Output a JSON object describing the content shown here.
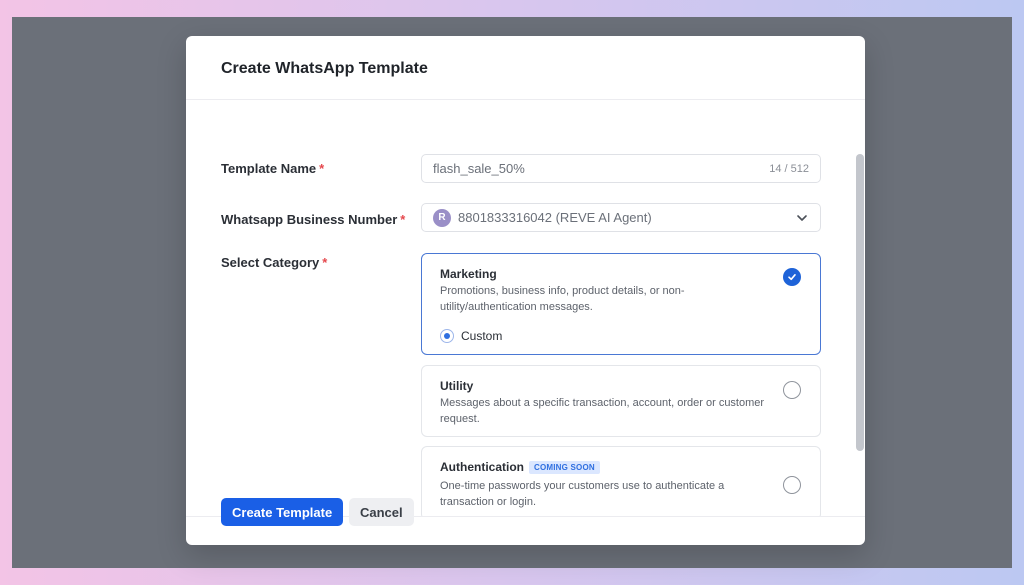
{
  "dialog": {
    "title": "Create WhatsApp Template"
  },
  "form": {
    "template_name": {
      "label": "Template Name",
      "required_mark": "*",
      "value": "flash_sale_50%",
      "counter": "14 / 512"
    },
    "business_number": {
      "label": "Whatsapp Business Number",
      "required_mark": "*",
      "avatar_letter": "R",
      "value": "8801833316042 (REVE AI Agent)",
      "icon": "chevron-down-icon"
    },
    "category": {
      "label": "Select Category",
      "required_mark": "*",
      "options": [
        {
          "title": "Marketing",
          "description": "Promotions, business info, product details, or non-utility/authentication messages.",
          "selected": true,
          "sub_option_label": "Custom"
        },
        {
          "title": "Utility",
          "description": "Messages about a specific transaction, account, order or customer request.",
          "selected": false
        },
        {
          "title": "Authentication",
          "badge": "COMING SOON",
          "description": "One-time passwords your customers use to authenticate a transaction or login.",
          "selected": false
        }
      ]
    }
  },
  "footer": {
    "primary_label": "Create Template",
    "secondary_label": "Cancel"
  },
  "colors": {
    "primary": "#1a5fe6",
    "required": "#e5484d",
    "selected_border": "#4a78d4",
    "overlay": "#6b7079"
  }
}
